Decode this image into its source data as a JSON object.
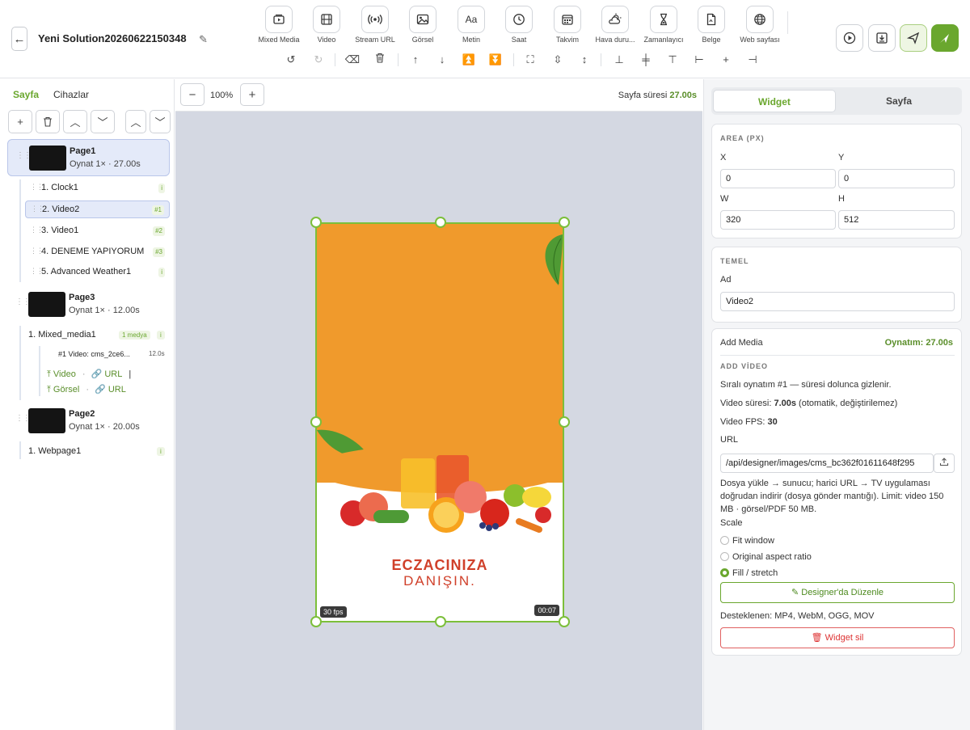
{
  "header": {
    "title": "Yeni Solution20260622150348",
    "tools": [
      {
        "label": "Mixed Media",
        "icon": "mixed-media-icon"
      },
      {
        "label": "Video",
        "icon": "video-icon"
      },
      {
        "label": "Stream URL",
        "icon": "stream-icon"
      },
      {
        "label": "Görsel",
        "icon": "image-icon"
      },
      {
        "label": "Metin",
        "icon": "text-icon"
      },
      {
        "label": "Saat",
        "icon": "clock-icon"
      },
      {
        "label": "Takvim",
        "icon": "calendar-icon"
      },
      {
        "label": "Hava duru...",
        "icon": "weather-icon"
      },
      {
        "label": "Zamanlayıcı",
        "icon": "timer-icon"
      },
      {
        "label": "Belge",
        "icon": "document-icon"
      },
      {
        "label": "Web sayfası",
        "icon": "globe-icon"
      }
    ],
    "metin_glyph": "Aa"
  },
  "left": {
    "tabs": [
      "Sayfa",
      "Cihazlar"
    ],
    "pages": [
      {
        "name": "Page1",
        "info": "Oynat 1× · 27.00s"
      },
      {
        "name": "Page3",
        "info": "Oynat 1× · 12.00s"
      },
      {
        "name": "Page2",
        "info": "Oynat 1× · 20.00s"
      }
    ],
    "page1_widgets": [
      {
        "label": "1.  Clock1",
        "badge": "i"
      },
      {
        "label": "2.  Video2",
        "badge": "#1"
      },
      {
        "label": "3.  Video1",
        "badge": "#2"
      },
      {
        "label": "4.  DENEME YAPIYORUM",
        "badge": "#3"
      },
      {
        "label": "5.  Advanced Weather1",
        "badge": "i"
      }
    ],
    "page3_mixed": {
      "label": "1.  Mixed_media1",
      "badge": "1 medya",
      "badge2": "i",
      "sub": "#1 Video: cms_2ce6...",
      "sub_dur": "12.0s"
    },
    "links": {
      "video": "Video",
      "url": "URL",
      "image": "Görsel",
      "url2": "URL"
    },
    "page2_widget": {
      "label": "1.  Webpage1",
      "badge": "i"
    }
  },
  "canvas": {
    "zoom": "100%",
    "duration_label": "Sayfa süresi",
    "duration_value": "27.00s",
    "fps": "30 fps",
    "time": "00:07",
    "ad_line1": "ECZACINIZA",
    "ad_line2": "DANIŞIN."
  },
  "right": {
    "tabs": [
      "Widget",
      "Sayfa"
    ],
    "area_title": "AREA (PX)",
    "x_label": "X",
    "x_value": "0",
    "y_label": "Y",
    "y_value": "0",
    "w_label": "W",
    "w_value": "320",
    "h_label": "H",
    "h_value": "512",
    "basic_title": "TEMEL",
    "name_label": "Ad",
    "name_value": "Video2",
    "add_media": "Add Media",
    "play_label": "Oynatım: 27.00s",
    "add_video": "ADD VİDEO",
    "order_text": "Sıralı oynatım #1 — süresi dolunca gizlenir.",
    "video_dur_label": "Video süresi: ",
    "video_dur_value": "7.00s",
    "video_dur_note": " (otomatik, değiştirilemez)",
    "fps_label": "Video FPS: ",
    "fps_value": "30",
    "url_label": "URL",
    "url_value": "/api/designer/images/cms_bc362f01611648f295",
    "help_text": "Dosya yükle → sunucu; harici URL → TV uygulaması doğrudan indirir (dosya gönder mantığı). Limit: video 150 MB · görsel/PDF 50 MB.",
    "scale_label": "Scale",
    "scale_options": [
      "Fit window",
      "Original aspect ratio",
      "Fill / stretch"
    ],
    "scale_selected": "Fill / stretch",
    "edit_button": "Designer'da Düzenle",
    "supported": "Desteklenen: MP4, WebM, OGG, MOV",
    "delete_button": "Widget sil"
  },
  "colors": {
    "accent": "#6aa72e",
    "selection": "#e4eaf9",
    "canvas_bg": "#d4d8e2",
    "ad_orange": "#f09a2c",
    "danger": "#dd3333"
  }
}
